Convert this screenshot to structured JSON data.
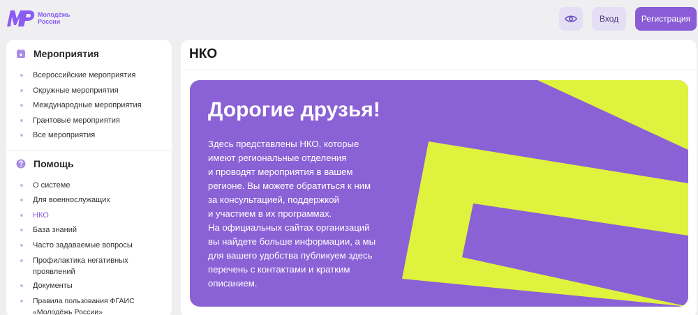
{
  "brand": {
    "line1": "Молодёжь",
    "line2": "России",
    "accent": "#8a5cf5"
  },
  "header": {
    "accessibility_icon": "eye-icon",
    "login_label": "Вход",
    "register_label": "Регистрация"
  },
  "sidebar": {
    "events": {
      "icon": "calendar-icon",
      "title": "Мероприятия",
      "items": [
        {
          "label": "Всероссийские мероприятия"
        },
        {
          "label": "Окружные мероприятия"
        },
        {
          "label": "Международные мероприятия"
        },
        {
          "label": "Грантовые мероприятия"
        },
        {
          "label": "Все мероприятия"
        }
      ]
    },
    "help": {
      "icon": "question-icon",
      "title": "Помощь",
      "items": [
        {
          "label": "О системе"
        },
        {
          "label": "Для военнослужащих"
        },
        {
          "label": "НКО",
          "active": true
        },
        {
          "label": "База знаний"
        },
        {
          "label": "Часто задаваемые вопросы"
        },
        {
          "label_line1": "Профилактика негативных",
          "label_line2": "проявлений"
        },
        {
          "label": "Документы"
        },
        {
          "label_line1": "Правила пользования ФГАИС",
          "label_line2": "«Молодёжь России»"
        }
      ]
    }
  },
  "main": {
    "title": "НКО",
    "banner": {
      "heading": "Дорогие друзья!",
      "lines": [
        "Здесь представлены НКО, которые",
        "имеют региональные отделения",
        "и проводят мероприятия в вашем",
        "регионе. Вы можете обратиться к ним",
        "за консультацией, поддержкой",
        "и участием в их программах.",
        "На официальных сайтах организаций",
        "вы найдете больше информации, а мы",
        "для вашего удобства публикуем здесь",
        "перечень с контактами и кратким",
        "описанием."
      ],
      "bg_color": "#8b61d6",
      "accent_color": "#dff23d"
    }
  }
}
